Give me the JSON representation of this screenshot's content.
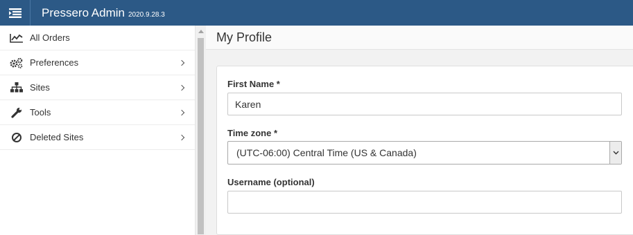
{
  "header": {
    "title": "Pressero Admin",
    "version": "2020.9.28.3",
    "menu_icon": "menu-toggle-icon",
    "color": "#2c5986"
  },
  "sidebar": {
    "items": [
      {
        "label": "All Orders",
        "icon": "line-chart-icon",
        "has_chevron": false
      },
      {
        "label": "Preferences",
        "icon": "gears-icon",
        "has_chevron": true
      },
      {
        "label": "Sites",
        "icon": "sitemap-icon",
        "has_chevron": true
      },
      {
        "label": "Tools",
        "icon": "wrench-icon",
        "has_chevron": true
      },
      {
        "label": "Deleted Sites",
        "icon": "ban-icon",
        "has_chevron": true
      }
    ]
  },
  "main": {
    "page_title": "My Profile",
    "form": {
      "first_name_label": "First Name *",
      "first_name_value": "Karen",
      "timezone_label": "Time zone *",
      "timezone_value": "(UTC-06:00) Central Time (US & Canada)",
      "username_label": "Username (optional)",
      "username_value": ""
    }
  }
}
